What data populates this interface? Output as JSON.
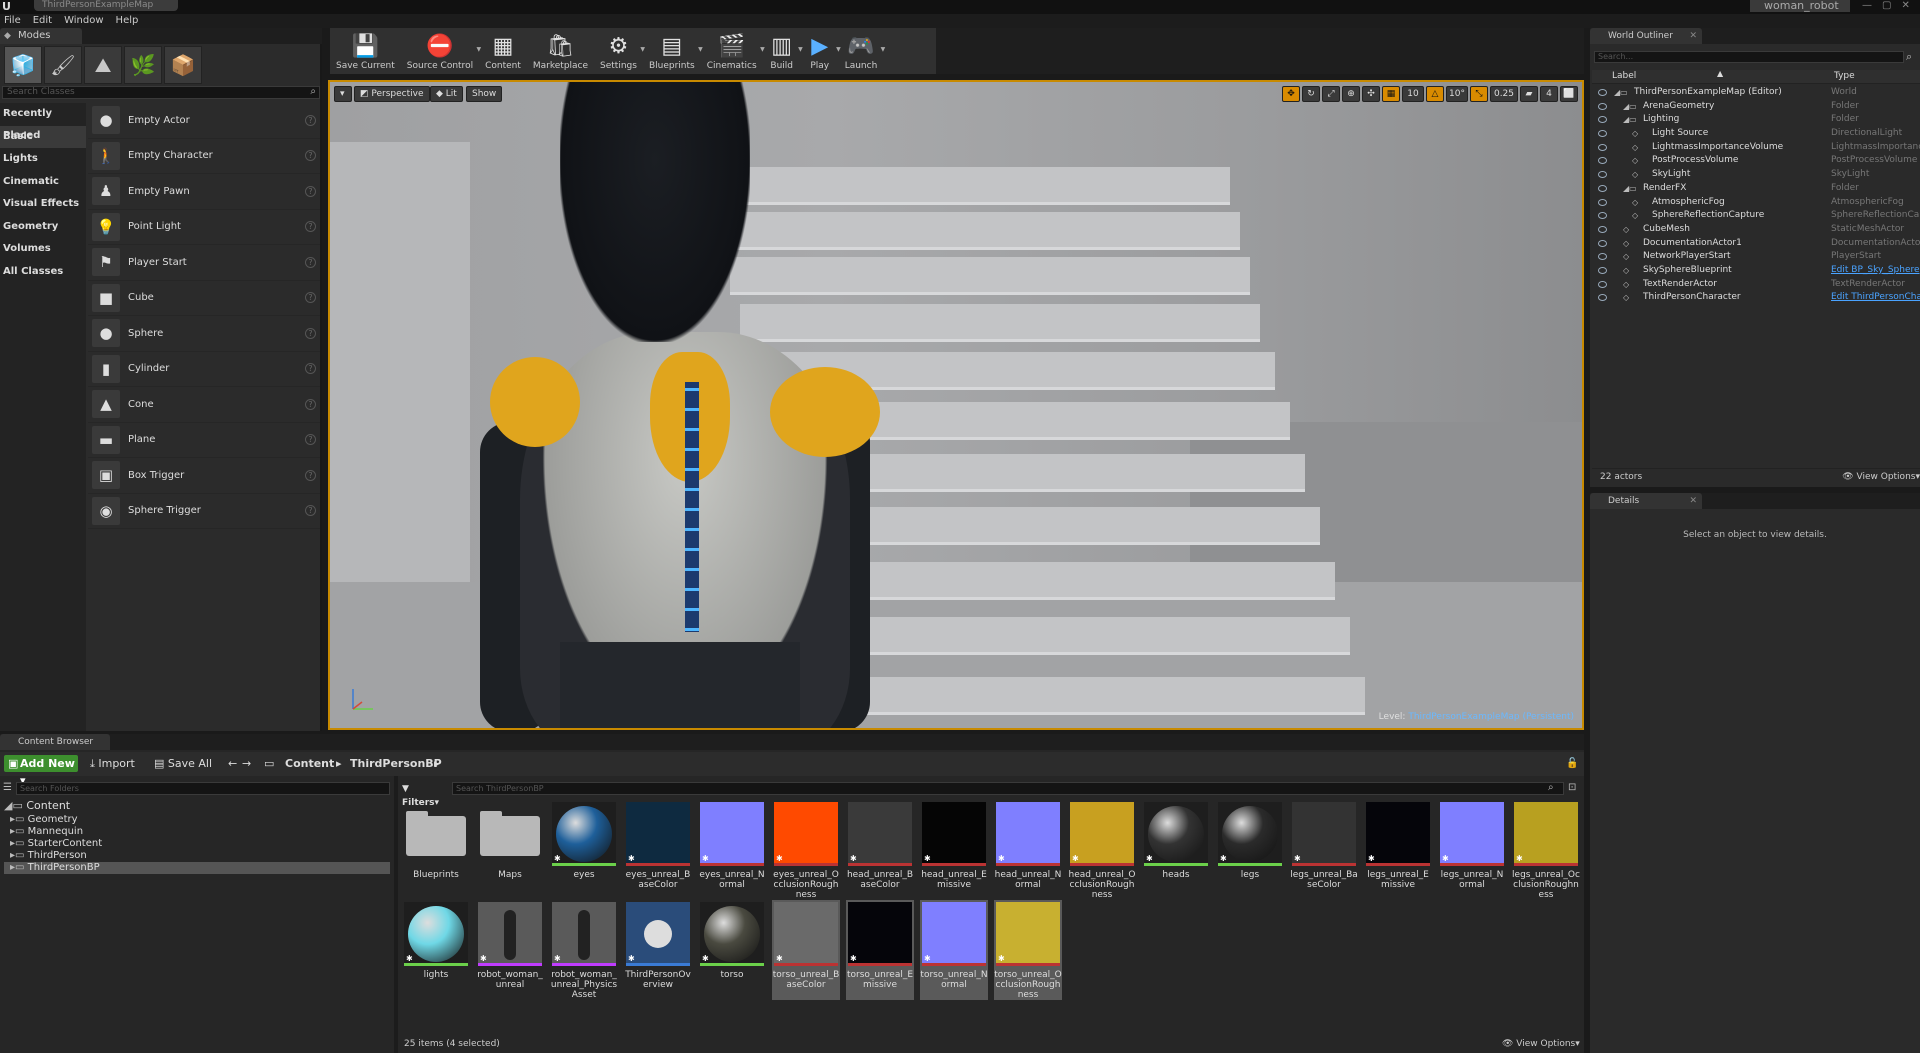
{
  "window": {
    "level_tab": "ThirdPersonExampleMap",
    "project_tab": "woman_robot",
    "ue_logo": "U"
  },
  "menu": [
    "File",
    "Edit",
    "Window",
    "Help"
  ],
  "modes": {
    "tab": "Modes",
    "search_placeholder": "Search Classes",
    "categories": [
      "Recently Placed",
      "Basic",
      "Lights",
      "Cinematic",
      "Visual Effects",
      "Geometry",
      "Volumes",
      "All Classes"
    ],
    "active_category": "Basic",
    "classes": [
      {
        "label": "Empty Actor",
        "icon": "sphere-icon"
      },
      {
        "label": "Empty Character",
        "icon": "character-icon"
      },
      {
        "label": "Empty Pawn",
        "icon": "pawn-icon"
      },
      {
        "label": "Point Light",
        "icon": "bulb-icon"
      },
      {
        "label": "Player Start",
        "icon": "player-start-icon"
      },
      {
        "label": "Cube",
        "icon": "cube-icon"
      },
      {
        "label": "Sphere",
        "icon": "sphere-icon"
      },
      {
        "label": "Cylinder",
        "icon": "cylinder-icon"
      },
      {
        "label": "Cone",
        "icon": "cone-icon"
      },
      {
        "label": "Plane",
        "icon": "plane-icon"
      },
      {
        "label": "Box Trigger",
        "icon": "box-trigger-icon"
      },
      {
        "label": "Sphere Trigger",
        "icon": "sphere-trigger-icon"
      }
    ]
  },
  "toolbar": {
    "buttons": [
      {
        "label": "Save Current",
        "icon": "💾",
        "name": "save-current",
        "drop": false
      },
      {
        "label": "Source Control",
        "icon": "⛔",
        "name": "source-control",
        "drop": true
      },
      {
        "label": "Content",
        "icon": "▦",
        "name": "content",
        "drop": false
      },
      {
        "label": "Marketplace",
        "icon": "🛍",
        "name": "marketplace",
        "drop": false
      },
      {
        "label": "Settings",
        "icon": "⚙",
        "name": "settings",
        "drop": true
      },
      {
        "label": "Blueprints",
        "icon": "▤",
        "name": "blueprints",
        "drop": true
      },
      {
        "label": "Cinematics",
        "icon": "🎬",
        "name": "cinematics",
        "drop": true
      },
      {
        "label": "Build",
        "icon": "▥",
        "name": "build",
        "drop": true
      },
      {
        "label": "Play",
        "icon": "▶",
        "name": "play",
        "drop": true
      },
      {
        "label": "Launch",
        "icon": "🎮",
        "name": "launch",
        "drop": true
      }
    ]
  },
  "viewport": {
    "perspective": "Perspective",
    "lit": "Lit",
    "show": "Show",
    "grid_snap": "10",
    "rot_snap": "10°",
    "scale_snap": "0.25",
    "camera_speed": "4",
    "level_label": "Level:",
    "level_name": "ThirdPersonExampleMap (Persistent)",
    "accent": "#c88a00"
  },
  "outliner": {
    "tab": "World Outliner",
    "search_placeholder": "Search...",
    "col_label": "Label",
    "col_type": "Type",
    "rows": [
      {
        "label": "ThirdPersonExampleMap (Editor)",
        "type": "World",
        "indent": 0,
        "link": false
      },
      {
        "label": "ArenaGeometry",
        "type": "Folder",
        "indent": 1,
        "link": false
      },
      {
        "label": "Lighting",
        "type": "Folder",
        "indent": 1,
        "link": false
      },
      {
        "label": "Light Source",
        "type": "DirectionalLight",
        "indent": 2,
        "link": false
      },
      {
        "label": "LightmassImportanceVolume",
        "type": "LightmassImportance",
        "indent": 2,
        "link": false
      },
      {
        "label": "PostProcessVolume",
        "type": "PostProcessVolume",
        "indent": 2,
        "link": false
      },
      {
        "label": "SkyLight",
        "type": "SkyLight",
        "indent": 2,
        "link": false
      },
      {
        "label": "RenderFX",
        "type": "Folder",
        "indent": 1,
        "link": false
      },
      {
        "label": "AtmosphericFog",
        "type": "AtmosphericFog",
        "indent": 2,
        "link": false
      },
      {
        "label": "SphereReflectionCapture",
        "type": "SphereReflectionCapt",
        "indent": 2,
        "link": false
      },
      {
        "label": "CubeMesh",
        "type": "StaticMeshActor",
        "indent": 1,
        "link": false
      },
      {
        "label": "DocumentationActor1",
        "type": "DocumentationActor",
        "indent": 1,
        "link": false
      },
      {
        "label": "NetworkPlayerStart",
        "type": "PlayerStart",
        "indent": 1,
        "link": false
      },
      {
        "label": "SkySphereBlueprint",
        "type": "Edit BP_Sky_Sphere",
        "indent": 1,
        "link": true
      },
      {
        "label": "TextRenderActor",
        "type": "TextRenderActor",
        "indent": 1,
        "link": false
      },
      {
        "label": "ThirdPersonCharacter",
        "type": "Edit ThirdPersonCha",
        "indent": 1,
        "link": true
      }
    ],
    "actor_count": "22 actors",
    "view_options": "View Options"
  },
  "details": {
    "tab": "Details",
    "message": "Select an object to view details."
  },
  "content_browser": {
    "tab": "Content Browser",
    "add_new": "Add New",
    "import": "Import",
    "save_all": "Save All",
    "path": [
      "Content",
      "ThirdPersonBP"
    ],
    "folder_search_placeholder": "Search Folders",
    "filters": "Filters",
    "asset_search_placeholder": "Search ThirdPersonBP",
    "tree": [
      {
        "label": "Content",
        "depth": 0,
        "selected": false
      },
      {
        "label": "Geometry",
        "depth": 1,
        "selected": false
      },
      {
        "label": "Mannequin",
        "depth": 1,
        "selected": false
      },
      {
        "label": "StarterContent",
        "depth": 1,
        "selected": false
      },
      {
        "label": "ThirdPerson",
        "depth": 1,
        "selected": false
      },
      {
        "label": "ThirdPersonBP",
        "depth": 1,
        "selected": true
      }
    ],
    "assets": [
      {
        "name": "Blueprints",
        "kind": "folder",
        "color": "#b8b8b8",
        "selected": false
      },
      {
        "name": "Maps",
        "kind": "folder",
        "color": "#b8b8b8",
        "selected": false
      },
      {
        "name": "eyes",
        "kind": "sphere",
        "color": "#1e5f9a",
        "selected": false
      },
      {
        "name": "eyes_unreal_BaseColor",
        "kind": "tex",
        "color": "#0e2a40",
        "selected": false
      },
      {
        "name": "eyes_unreal_Normal",
        "kind": "tex",
        "color": "#7f7fff",
        "selected": false
      },
      {
        "name": "eyes_unreal_OcclusionRoughness",
        "kind": "tex",
        "color": "#ff4a00",
        "selected": false
      },
      {
        "name": "head_unreal_BaseColor",
        "kind": "tex",
        "color": "#3a3a3a",
        "selected": false
      },
      {
        "name": "head_unreal_Emissive",
        "kind": "tex",
        "color": "#050505",
        "selected": false
      },
      {
        "name": "head_unreal_Normal",
        "kind": "tex",
        "color": "#7f7fff",
        "selected": false
      },
      {
        "name": "head_unreal_OcclusionRoughness",
        "kind": "tex",
        "color": "#c8a020",
        "selected": false
      },
      {
        "name": "heads",
        "kind": "sphere",
        "color": "#333",
        "selected": false
      },
      {
        "name": "legs",
        "kind": "sphere",
        "color": "#2b2b2b",
        "selected": false
      },
      {
        "name": "legs_unreal_BaseColor",
        "kind": "tex",
        "color": "#333",
        "selected": false
      },
      {
        "name": "legs_unreal_Emissive",
        "kind": "tex",
        "color": "#05050a",
        "selected": false
      },
      {
        "name": "legs_unreal_Normal",
        "kind": "tex",
        "color": "#7f7fff",
        "selected": false
      },
      {
        "name": "legs_unreal_OcclusionRoughness",
        "kind": "tex",
        "color": "#b8a020",
        "selected": false
      },
      {
        "name": "lights",
        "kind": "sphere",
        "color": "#6fd8e6",
        "selected": false
      },
      {
        "name": "robot_woman_unreal",
        "kind": "mesh",
        "color": "#444",
        "selected": false
      },
      {
        "name": "robot_woman_unreal_PhysicsAsset",
        "kind": "mesh",
        "color": "#444",
        "selected": false
      },
      {
        "name": "ThirdPersonOverview",
        "kind": "overview",
        "color": "#2a4c7a",
        "selected": false
      },
      {
        "name": "torso",
        "kind": "sphere",
        "color": "#4a4a40",
        "selected": false
      },
      {
        "name": "torso_unreal_BaseColor",
        "kind": "tex",
        "color": "#6a6a6a",
        "selected": true
      },
      {
        "name": "torso_unreal_Emissive",
        "kind": "tex",
        "color": "#05050a",
        "selected": true
      },
      {
        "name": "torso_unreal_Normal",
        "kind": "tex",
        "color": "#7f7fff",
        "selected": true
      },
      {
        "name": "torso_unreal_OcclusionRoughness",
        "kind": "tex",
        "color": "#c8b030",
        "selected": true
      }
    ],
    "status": "25 items (4 selected)",
    "view_options": "View Options"
  }
}
